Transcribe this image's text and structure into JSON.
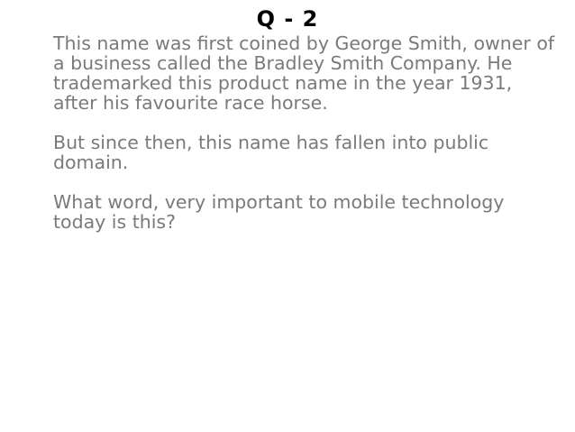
{
  "slide": {
    "title": "Q - 2",
    "paragraphs": [
      "This name was first coined by George Smith, owner of a business called the Bradley Smith Company. He trademarked this product name in the year 1931, after his favourite race horse.",
      "But since then, this name has fallen into public domain.",
      "What word, very important to mobile technology today is this?"
    ],
    "colors": {
      "background": "#ffffff",
      "title": "#000000",
      "body_text": "#7a7a7a"
    }
  }
}
